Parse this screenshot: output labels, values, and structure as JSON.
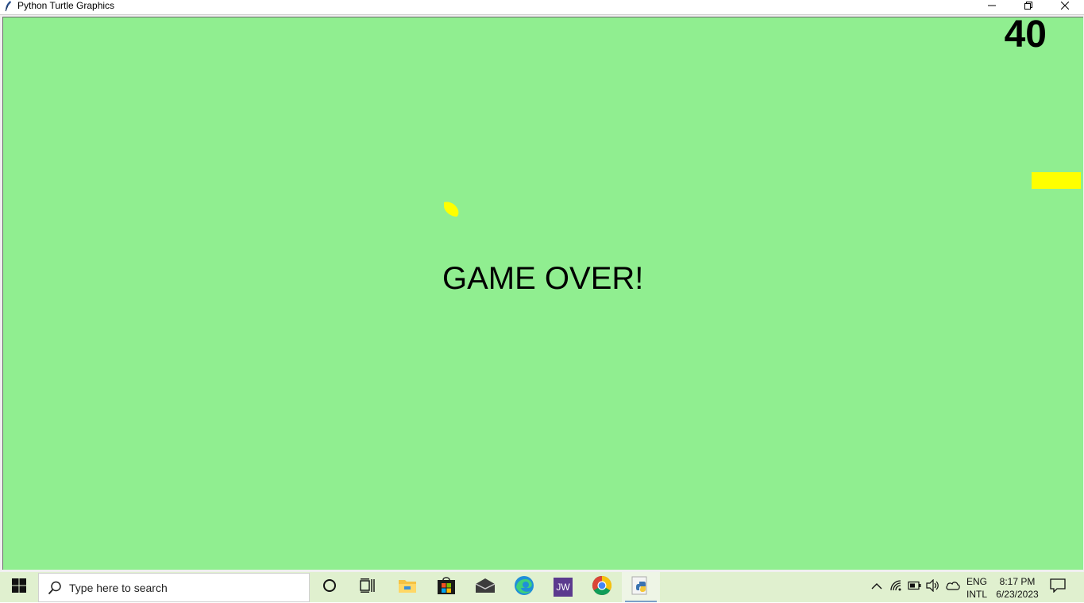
{
  "window": {
    "title": "Python Turtle Graphics",
    "icons": {
      "app": "feather-icon",
      "minimize": "minimize-icon",
      "maximize": "restore-icon",
      "close": "close-icon"
    }
  },
  "game": {
    "score": "40",
    "message": "GAME OVER!",
    "background_color": "#90ee90",
    "food_color": "#ffff00",
    "paddle_color": "#ffff00"
  },
  "taskbar": {
    "search_placeholder": "Type here to search",
    "apps": [
      "start-icon",
      "cortana-icon",
      "task-view-icon",
      "file-explorer-icon",
      "store-icon",
      "mail-icon",
      "edge-icon",
      "jw-icon",
      "chrome-icon",
      "python-icon"
    ],
    "jw_label": "JW",
    "tray": {
      "lang_line1": "ENG",
      "lang_line2": "INTL",
      "time": "8:17 PM",
      "date": "6/23/2023"
    }
  }
}
